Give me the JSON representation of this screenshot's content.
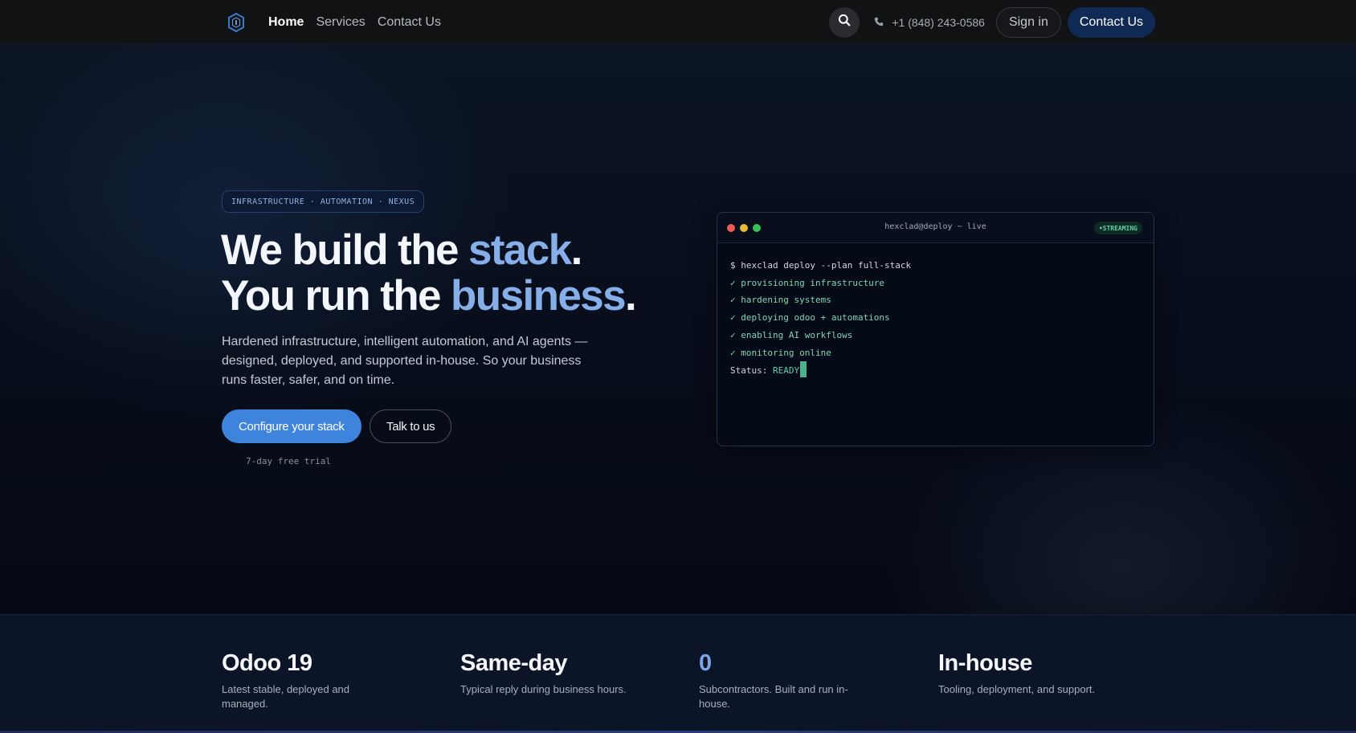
{
  "nav": {
    "links": [
      {
        "label": "Home",
        "active": true
      },
      {
        "label": "Services",
        "active": false
      },
      {
        "label": "Contact Us",
        "active": false
      }
    ],
    "phone": "+1 (848) 243-0586",
    "signin_label": "Sign in",
    "contact_label": "Contact Us",
    "logo_icon": "hexagon-shield-icon",
    "search_icon": "search-icon",
    "phone_icon": "phone-icon"
  },
  "hero": {
    "tag": "INFRASTRUCTURE · AUTOMATION · NEXUS",
    "headline": {
      "line1_prefix": "We build the ",
      "line1_accent": "stack",
      "line1_suffix": ".",
      "line2_prefix": "You run the ",
      "line2_accent": "business",
      "line2_suffix": "."
    },
    "subtext": "Hardened infrastructure, intelligent automation, and AI agents — designed, deployed, and supported in-house. So your business runs faster, safer, and on time.",
    "primary_cta": "Configure your stack",
    "secondary_cta": "Talk to us",
    "trial_note": "7-day free trial"
  },
  "terminal": {
    "title": "hexclad@deploy ~ live",
    "status_badge": "•STREAMING",
    "command": "$ hexclad deploy --plan full-stack",
    "steps": [
      "✓ provisioning infrastructure",
      "✓ hardening systems",
      "✓ deploying odoo + automations",
      "✓ enabling AI workflows",
      "✓ monitoring online"
    ],
    "status_label": "Status: ",
    "status_value": "READY"
  },
  "stats": [
    {
      "value": "Odoo 19",
      "desc": "Latest stable, deployed and managed."
    },
    {
      "value": "Same-day",
      "desc": "Typical reply during business hours."
    },
    {
      "value": "0",
      "desc": "Subcontractors. Built and run in-house."
    },
    {
      "value": "In-house",
      "desc": "Tooling, deployment, and support."
    }
  ],
  "colors": {
    "accent": "#86aee9",
    "primary_button": "#3f84dc",
    "contact_button": "#0e2a55",
    "terminal_ok": "#7fd6b3",
    "dot_red": "#ef5b57",
    "dot_yellow": "#e9b92f",
    "dot_green": "#36c15a"
  }
}
